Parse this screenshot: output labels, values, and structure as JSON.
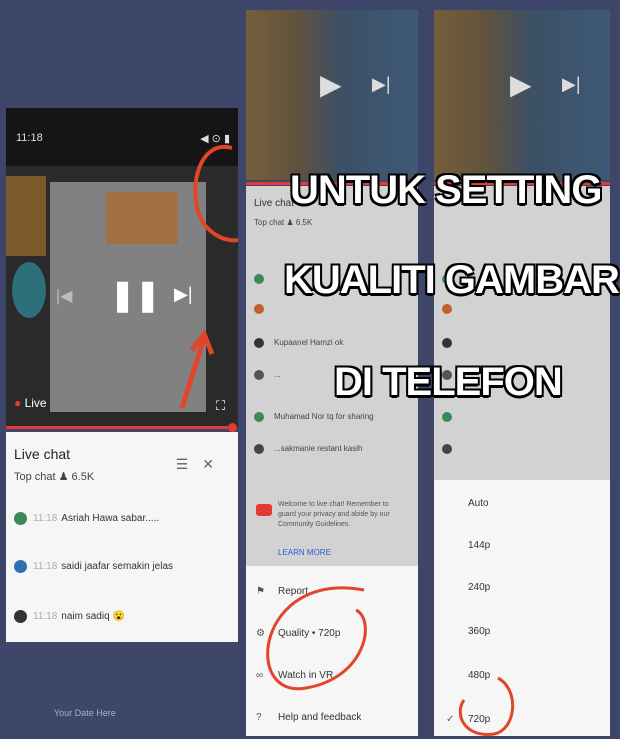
{
  "overlay": {
    "line1": "UNTUK SETTING",
    "line2": "KUALITI GAMBAR",
    "line3": "DI TELEFON"
  },
  "panel1": {
    "status_time": "11:18",
    "status_right": "◀ ⊙ ▮",
    "live_label": "Live",
    "chat_title": "Live chat",
    "chat_sub": "Top chat  ♟ 6.5K",
    "messages": [
      {
        "time": "11:18",
        "text": "Asriah Hawa  sabar....."
      },
      {
        "time": "11:18",
        "text": "saidi jaafar  semakin jelas"
      },
      {
        "time": "11:18",
        "text": "naim sadiq"
      }
    ],
    "footer": "Your Date Here"
  },
  "panel2": {
    "chat_title": "Live chat",
    "chat_sub": "Top chat  ♟ 6.5K",
    "rows": [
      "Kupaanel Hamzi ok",
      "...",
      "Muhamad Nor  tq for sharing",
      "...sakmanie  restant kasih"
    ],
    "notice": "Welcome to live chat! Remember to guard your privacy and abide by our Community Guidelines.",
    "learn_more": "LEARN MORE",
    "menu": [
      "Report",
      "Quality  •  720p",
      "Watch in VR",
      "Help and feedback"
    ]
  },
  "panel3": {
    "quality_options": [
      "Auto",
      "144p",
      "240p",
      "360p",
      "480p",
      "720p"
    ],
    "selected": "720p"
  },
  "colors": {
    "background": "#3d4668",
    "accent_red": "#e53935",
    "annotation_red": "#e2452a"
  }
}
